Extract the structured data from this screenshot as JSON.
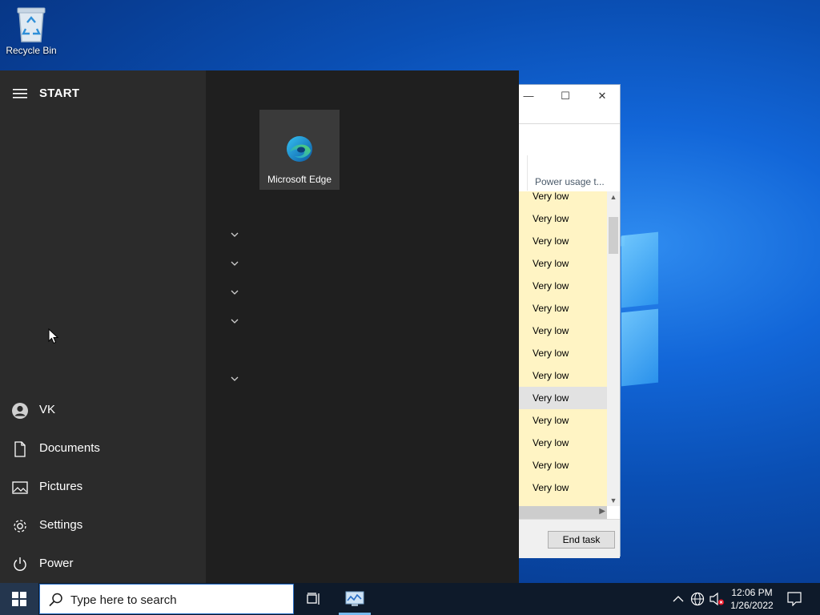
{
  "desktop": {
    "recycle_bin_label": "Recycle Bin"
  },
  "task_manager": {
    "column_header": "Power usage t...",
    "rows": [
      "Very low",
      "Very low",
      "Very low",
      "Very low",
      "Very low",
      "Very low",
      "Very low",
      "Very low",
      "Very low",
      "Very low",
      "Very low",
      "Very low",
      "Very low",
      "Very low"
    ],
    "selected_row_index": 9,
    "end_task_label": "End task",
    "accent_row_color": "#fff4c4"
  },
  "start_menu": {
    "title": "START",
    "user_name": "VK",
    "items": [
      {
        "label": "Documents",
        "icon": "document-icon"
      },
      {
        "label": "Pictures",
        "icon": "pictures-icon"
      },
      {
        "label": "Settings",
        "icon": "gear-icon"
      },
      {
        "label": "Power",
        "icon": "power-icon"
      }
    ],
    "tile": {
      "label": "Microsoft Edge",
      "icon": "edge-icon"
    },
    "group_chevrons": 5
  },
  "taskbar": {
    "search_placeholder": "Type here to search",
    "clock_time": "12:06 PM",
    "clock_date": "1/26/2022",
    "accent_color": "#76b9ed"
  }
}
